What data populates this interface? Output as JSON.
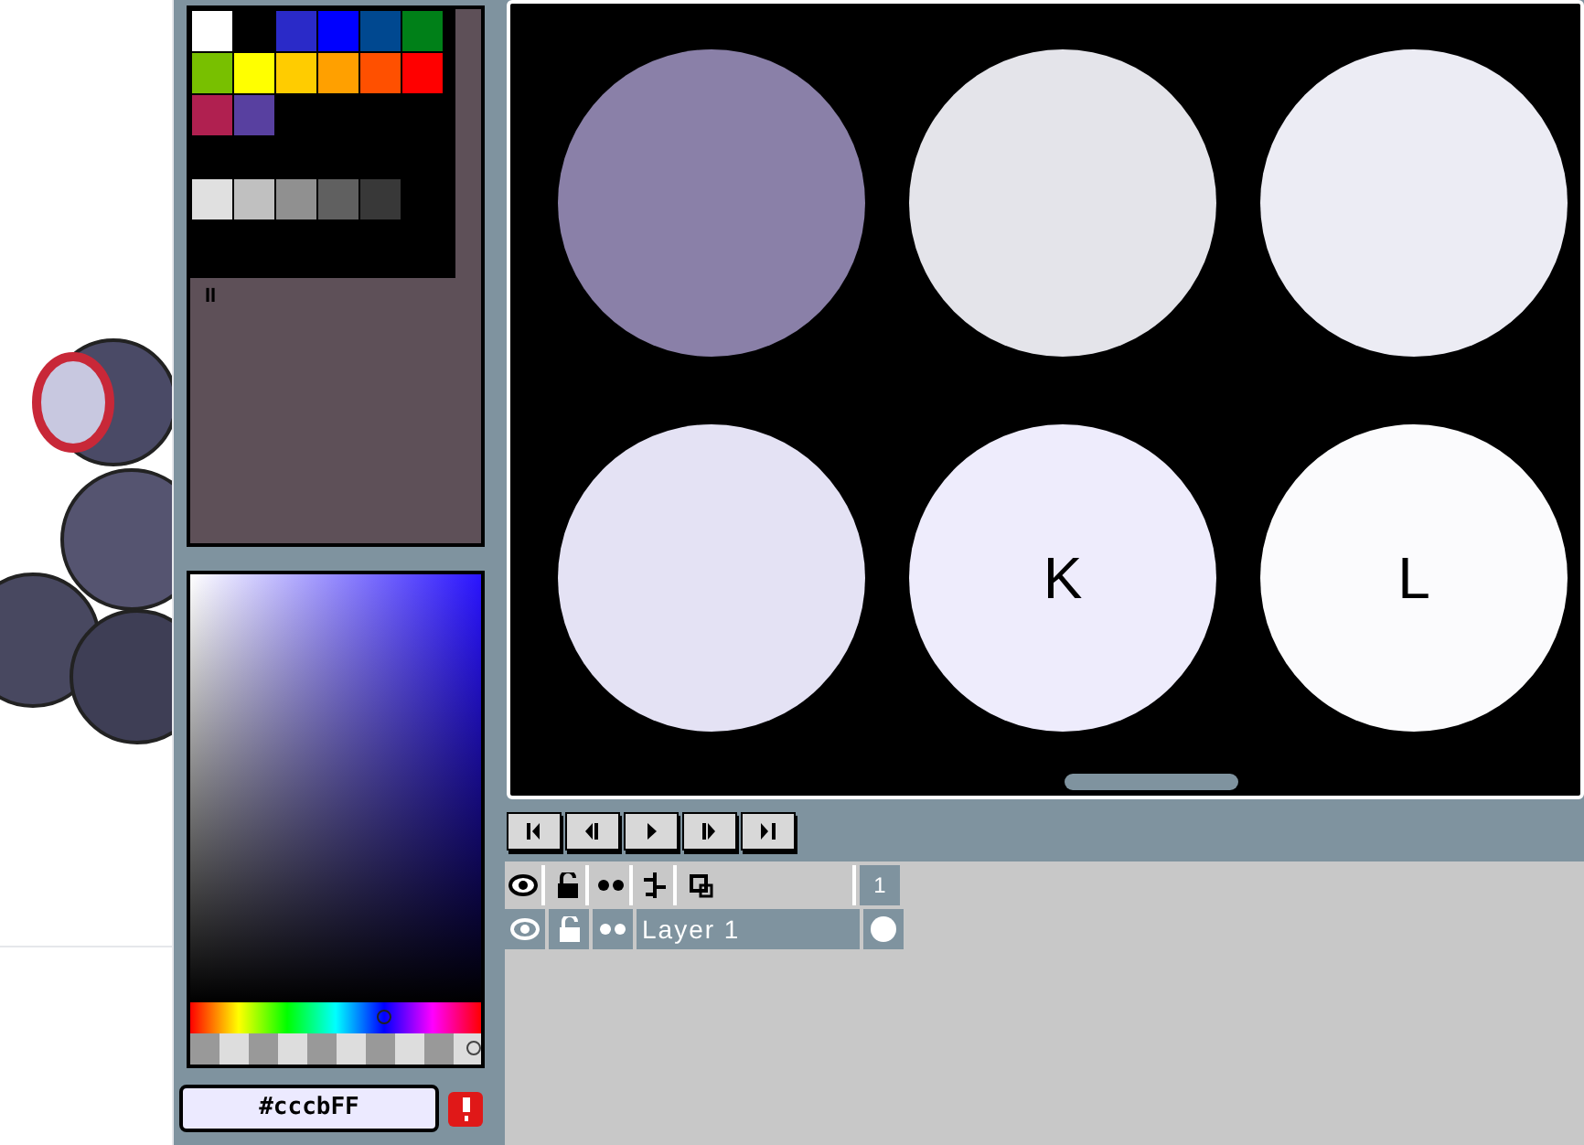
{
  "palette": {
    "swatch_rows": [
      [
        {
          "color": "#ffffff"
        },
        null,
        {
          "color": "#2a2ac8"
        },
        {
          "color": "#0000ff"
        },
        {
          "color": "#004890"
        },
        {
          "color": "#008018"
        }
      ],
      [
        {
          "color": "#78c000"
        },
        {
          "color": "#ffff00"
        },
        {
          "color": "#ffcc00"
        },
        {
          "color": "#ffa000"
        },
        {
          "color": "#ff5000"
        },
        {
          "color": "#ff0000"
        }
      ],
      [
        {
          "color": "#b02050"
        },
        {
          "color": "#5840a0"
        }
      ],
      [],
      [
        {
          "color": "#e0e0e0"
        },
        {
          "color": "#c0c0c0"
        },
        {
          "color": "#909090"
        },
        {
          "color": "#606060"
        },
        {
          "color": "#383838"
        }
      ]
    ],
    "label": "II"
  },
  "color_picker": {
    "hue_slider": {
      "level": 0.69
    },
    "alpha_slider": {
      "level": 1
    },
    "hex_value": "#cccbFF"
  },
  "canvas": {
    "circles": [
      {
        "color": "#8a80a8"
      },
      {
        "color": "#e4e4ea"
      },
      {
        "color": "#ececf4"
      },
      {
        "color": "#e4e2f4"
      },
      {
        "color": "#eeecfc",
        "label": "K"
      },
      {
        "color": "#fbfbfd",
        "label": "L"
      }
    ]
  },
  "layers": {
    "frame_number": "1",
    "rows": [
      {
        "name": "Layer 1",
        "selected": true
      }
    ]
  }
}
